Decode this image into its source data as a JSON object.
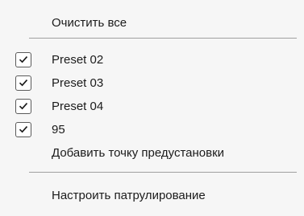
{
  "menu": {
    "clear_all": "Очистить все",
    "presets": [
      {
        "label": "Preset 02",
        "checked": true
      },
      {
        "label": "Preset 03",
        "checked": true
      },
      {
        "label": "Preset 04",
        "checked": true
      },
      {
        "label": "95",
        "checked": true
      }
    ],
    "add_preset": "Добавить точку предустановки",
    "configure_patrol": "Настроить патрулирование"
  },
  "icons": {
    "check": "checkmark-icon"
  }
}
